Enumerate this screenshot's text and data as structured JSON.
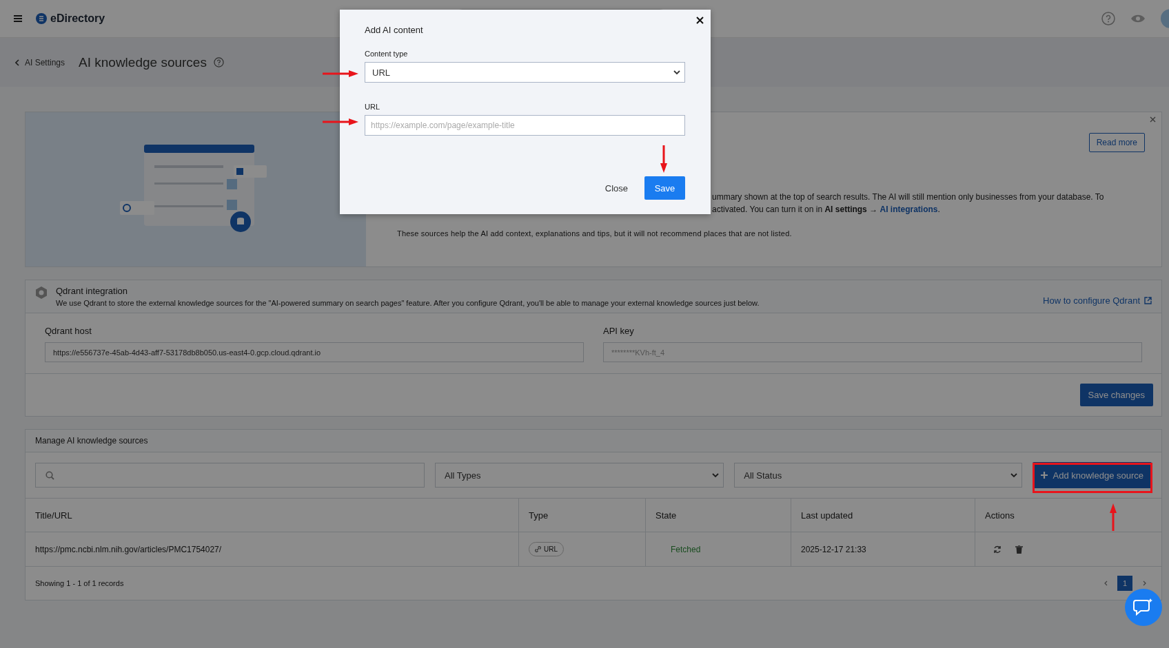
{
  "topbar": {
    "logo": "eDirectory"
  },
  "header": {
    "back": "AI Settings",
    "title": "AI knowledge sources"
  },
  "info_card": {
    "read_more": "Read more",
    "lines": [
      "ummary shown at the top of search results. The AI will still mention only businesses from your database. To"
    ],
    "settings_line": {
      "text": "activated. You can turn it on in **AI settings** →",
      "link": "AI integrations",
      "after": "."
    },
    "note": "These sources help the AI add context, explanations and tips, but it will not recommend places that are not listed."
  },
  "qdrant": {
    "title": "Qdrant integration",
    "description": "We use Qdrant to store the external knowledge sources for the \"AI-powered summary on search pages\" feature. After you configure Qdrant, you'll be able to manage your external knowledge sources just below.",
    "link": "How to configure Qdrant",
    "fields": [
      {
        "label": "Qdrant host",
        "value": "https://e556737e-45ab-4d43-aff7-53178db8b050.us-east4-0.gcp.cloud.qdrant.io",
        "masked": false
      },
      {
        "label": "API key",
        "value": "********KVh-ft_4",
        "masked": true
      }
    ],
    "save": "Save changes"
  },
  "manage": {
    "title": "Manage AI knowledge sources",
    "type_filter": "All Types",
    "status_filter": "All Status",
    "add": "Add knowledge source",
    "columns": [
      "Title/URL",
      "Type",
      "State",
      "Last updated",
      "Actions"
    ],
    "rows": [
      {
        "title": "https://pmc.ncbi.nlm.nih.gov/articles/PMC1754027/",
        "type": "URL",
        "state": "Fetched",
        "updated": "2025-12-17 21:33"
      }
    ],
    "footer": "Showing 1 - 1 of 1 records",
    "pages": [
      {
        "label": "1",
        "selected": true
      }
    ]
  },
  "modal": {
    "title": "Add AI content",
    "type_label": "Content type",
    "type_value": "URL",
    "url_label": "URL",
    "url_placeholder": "https://example.com/page/example-title",
    "close": "Close",
    "save": "Save"
  }
}
